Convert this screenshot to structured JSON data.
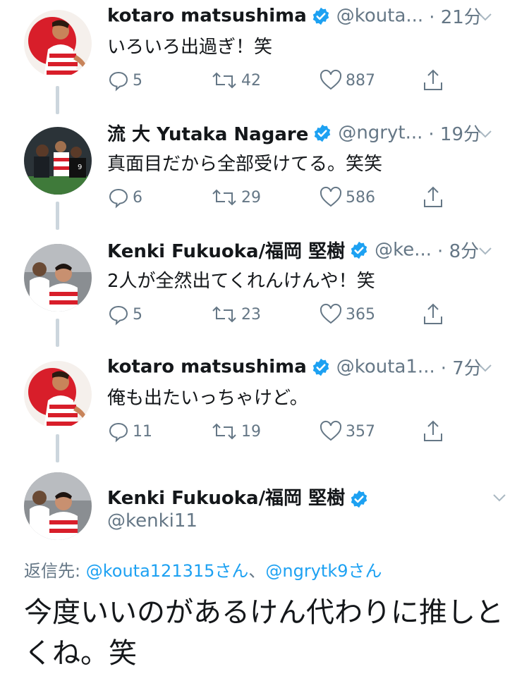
{
  "tweets": [
    {
      "name": "kotaro matsushima",
      "handle": "@kouta...",
      "time": "· 21分",
      "text": "いろいろ出過ぎ！笑",
      "replies": "5",
      "retweets": "42",
      "likes": "887"
    },
    {
      "name": "流 大 Yutaka Nagare",
      "handle": "@ngryt...",
      "time": "· 19分",
      "text": "真面目だから全部受けてる。笑笑",
      "replies": "6",
      "retweets": "29",
      "likes": "586"
    },
    {
      "name": "Kenki Fukuoka/福岡 堅樹",
      "handle": "@ke...",
      "time": "· 8分",
      "text": "2人が全然出てくれんけんや！笑",
      "replies": "5",
      "retweets": "23",
      "likes": "365"
    },
    {
      "name": "kotaro matsushima",
      "handle": "@kouta1...",
      "time": "· 7分",
      "text": "俺も出たいっちゃけど。",
      "replies": "11",
      "retweets": "19",
      "likes": "357"
    }
  ],
  "focus": {
    "name": "Kenki Fukuoka/福岡 堅樹",
    "handle": "@kenki11",
    "reply_prefix": "返信先: ",
    "reply_link1": "@kouta121315さん",
    "reply_sep": "、",
    "reply_link2": "@ngrytk9さん",
    "text": "今度いいのがあるけん代わりに推しとくね。笑"
  },
  "icons": {
    "verified": "verified-badge-icon",
    "reply": "reply-icon",
    "retweet": "retweet-icon",
    "like": "heart-icon",
    "share": "share-icon",
    "menu": "chevron-down-icon"
  },
  "colors": {
    "accent": "#1da1f2",
    "secondary_text": "#657786",
    "primary_text": "#14171a",
    "thread_line": "#ccd6dd"
  }
}
